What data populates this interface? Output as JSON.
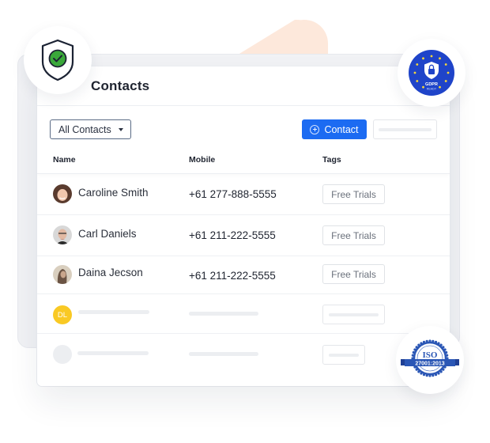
{
  "page": {
    "title": "Contacts"
  },
  "toolbar": {
    "filter": {
      "selected": "All Contacts",
      "icon": "caret-down-icon"
    },
    "add_button": {
      "label": "Contact",
      "icon": "plus-circle-icon"
    },
    "search": {
      "value": ""
    }
  },
  "table": {
    "columns": [
      "Name",
      "Mobile",
      "Tags"
    ],
    "rows": [
      {
        "name": "Caroline Smith",
        "mobile": "+61 277-888-5555",
        "tag": "Free Trials",
        "avatar": "photo"
      },
      {
        "name": "Carl Daniels",
        "mobile": "+61 211-222-5555",
        "tag": "Free Trials",
        "avatar": "photo"
      },
      {
        "name": "Daina Jecson",
        "mobile": "+61 211-222-5555",
        "tag": "Free Trials",
        "avatar": "photo"
      },
      {
        "name": "",
        "mobile": "",
        "tag": "",
        "avatar": "initials",
        "initials": "DL",
        "placeholder": true
      },
      {
        "name": "",
        "mobile": "",
        "tag": "",
        "avatar": "empty",
        "placeholder": true
      }
    ]
  },
  "badges": {
    "security": {
      "icon": "shield-check-icon"
    },
    "gdpr": {
      "line1": "GDPR",
      "line2": "READY",
      "icon": "lock-shield-icon"
    },
    "iso": {
      "title": "ISO",
      "code": "27001:2013"
    }
  },
  "colors": {
    "accent": "#1c6bf2",
    "gdpr_blue": "#1f44c9",
    "iso_blue": "#2a56b5",
    "check_green": "#3aa83a",
    "initials_yellow": "#f9c924",
    "blob_peach": "#fde8db"
  }
}
